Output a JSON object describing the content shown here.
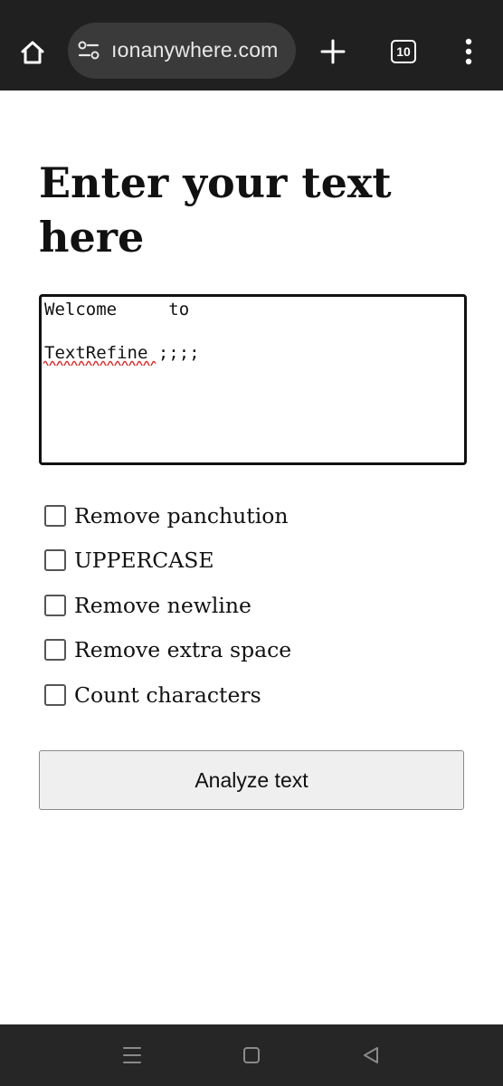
{
  "browser": {
    "url_display": "ıonanywhere.com",
    "tab_count": "10",
    "icons": {
      "home": "home-icon",
      "site_info": "site-info-icon",
      "new_tab": "plus-icon",
      "tabs": "tab-switcher-icon",
      "menu": "more-vert-icon"
    },
    "colors": {
      "toolbar_bg": "#202020",
      "url_pill_bg": "#3a3a3a",
      "icon": "#ffffff"
    }
  },
  "page": {
    "title": "Enter your text here",
    "textarea_value": "Welcome     to\n\nTextRefine ;;;;",
    "options": [
      {
        "label": "Remove panchution",
        "checked": false
      },
      {
        "label": "UPPERCASE",
        "checked": false
      },
      {
        "label": "Remove newline",
        "checked": false
      },
      {
        "label": "Remove extra space",
        "checked": false
      },
      {
        "label": "Count characters",
        "checked": false
      }
    ],
    "analyze_label": "Analyze text"
  },
  "system_nav": {
    "icons": [
      "recents-icon",
      "home-nav-icon",
      "back-icon"
    ],
    "colors": {
      "bg": "#262626",
      "icon": "#8a8a8a"
    }
  }
}
